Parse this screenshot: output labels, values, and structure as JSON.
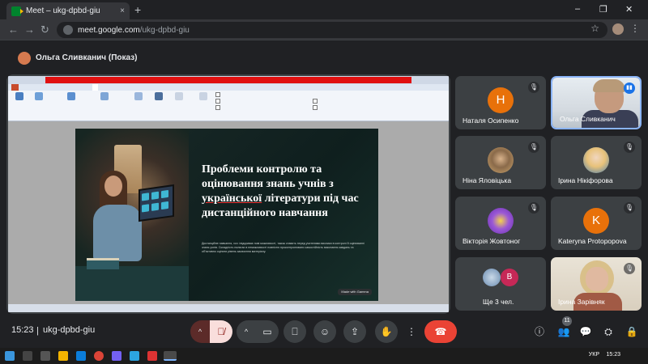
{
  "browser": {
    "tab_title": "Meet – ukg-dpbd-giu",
    "tab_close": "×",
    "new_tab": "+",
    "url_host": "meet.google.com",
    "url_path": "/ukg-dpbd-giu",
    "window_minimize": "–",
    "window_maximize": "❐",
    "window_close": "✕"
  },
  "presenter": {
    "name": "Ольга Сливканич (Показ)"
  },
  "presentation": {
    "slide_title_part1": "Проблеми контролю та оцінювання знань учнів з",
    "slide_title_underlined": "української",
    "slide_title_part2": "літератури під час дистанційного навчання",
    "slide_body": "Дистанційне навчання, хоч і відкриває нові можливості, також ставить перед учителями виклики в контролі й оцінюванні знань учнів. Складність полягає в неможливості повністю проконтролювати самостійність виконання завдань та об'єктивно оцінити рівень засвоєння матеріалу.",
    "badge": "Made with Gamma"
  },
  "participants": [
    {
      "name": "Наталя Осипенко",
      "initial": "Н",
      "color": "#e8710a",
      "muted": true
    },
    {
      "name": "Ольга Сливканич",
      "muted": false,
      "speaking": true
    },
    {
      "name": "Ніна Яловіцька",
      "muted": true
    },
    {
      "name": "Ірина Нікіфорова",
      "muted": true
    },
    {
      "name": "Вікторія Жовтоног",
      "muted": true
    },
    {
      "name": "Kateryna Protopopova",
      "initial": "K",
      "color": "#e8710a",
      "muted": true
    },
    {
      "name": "Ще 3 чел.",
      "initial": "В",
      "color": "#c62857"
    },
    {
      "name": "Ірина Зарівняк",
      "muted": true
    }
  ],
  "meeting": {
    "time": "15:23",
    "separator": "|",
    "code": "ukg-dpbd-giu",
    "people_count": "11"
  },
  "taskbar": {
    "lang": "УКР",
    "time": "15:23"
  },
  "colors": {
    "accent": "#8ab4f8",
    "leave": "#ea4335",
    "mic_off_bg": "#f9dedc"
  }
}
